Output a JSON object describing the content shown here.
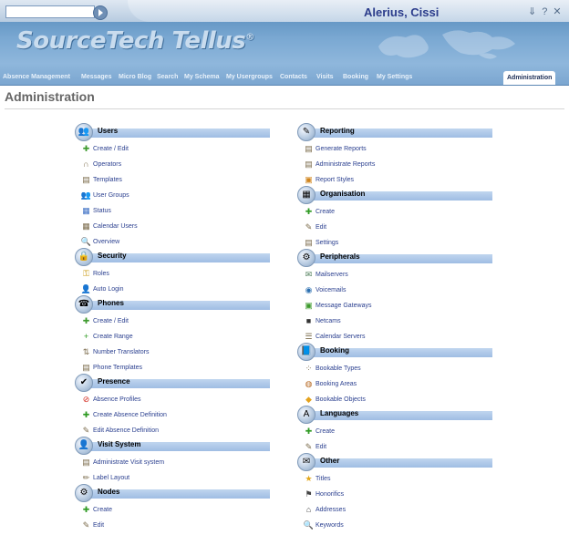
{
  "header": {
    "user_name": "Alerius, Cissi",
    "logo_text": "SourceTech Tellus",
    "logo_mark": "®",
    "top_icons": "⇓?✕"
  },
  "nav": [
    {
      "label": "Absence Management"
    },
    {
      "label": "Messages"
    },
    {
      "label": "Micro Blog"
    },
    {
      "label": "Search"
    },
    {
      "label": "My Schema"
    },
    {
      "label": "My Usergroups"
    },
    {
      "label": "Contacts"
    },
    {
      "label": "Visits"
    },
    {
      "label": "Booking"
    },
    {
      "label": "My Settings"
    },
    {
      "label": "Administration"
    }
  ],
  "page": {
    "title": "Administration"
  },
  "left_sections": [
    {
      "title": "Users",
      "icon": "users-icon",
      "items": [
        {
          "label": "Create / Edit",
          "icon": "person-add-icon"
        },
        {
          "label": "Operators",
          "icon": "headset-icon"
        },
        {
          "label": "Templates",
          "icon": "template-icon"
        },
        {
          "label": "User Groups",
          "icon": "group-icon"
        },
        {
          "label": "Status",
          "icon": "status-icon"
        },
        {
          "label": "Calendar Users",
          "icon": "calendar-users-icon"
        },
        {
          "label": "Overview",
          "icon": "magnifier-icon"
        }
      ]
    },
    {
      "title": "Security",
      "icon": "security-icon",
      "items": [
        {
          "label": "Roles",
          "icon": "key-icon"
        },
        {
          "label": "Auto Login",
          "icon": "auto-login-icon"
        }
      ]
    },
    {
      "title": "Phones",
      "icon": "phones-icon",
      "items": [
        {
          "label": "Create / Edit",
          "icon": "person-add-icon"
        },
        {
          "label": "Create Range",
          "icon": "plus-range-icon"
        },
        {
          "label": "Number Translators",
          "icon": "translate-icon"
        },
        {
          "label": "Phone Templates",
          "icon": "template-icon"
        }
      ]
    },
    {
      "title": "Presence",
      "icon": "presence-icon",
      "items": [
        {
          "label": "Absence Profiles",
          "icon": "no-entry-icon"
        },
        {
          "label": "Create Absence Definition",
          "icon": "plus-icon"
        },
        {
          "label": "Edit Absence Definition",
          "icon": "edit-icon"
        }
      ]
    },
    {
      "title": "Visit System",
      "icon": "visit-system-icon",
      "items": [
        {
          "label": "Administrate Visit system",
          "icon": "visit-admin-icon"
        },
        {
          "label": "Label Layout",
          "icon": "pencil-icon"
        }
      ]
    },
    {
      "title": "Nodes",
      "icon": "nodes-icon",
      "items": [
        {
          "label": "Create",
          "icon": "plus-icon"
        },
        {
          "label": "Edit",
          "icon": "edit-icon"
        }
      ]
    }
  ],
  "right_sections": [
    {
      "title": "Reporting",
      "icon": "reporting-icon",
      "items": [
        {
          "label": "Generate Reports",
          "icon": "report-icon"
        },
        {
          "label": "Administrate Reports",
          "icon": "report-icon"
        },
        {
          "label": "Report Styles",
          "icon": "report-style-icon"
        }
      ]
    },
    {
      "title": "Organisation",
      "icon": "organisation-icon",
      "items": [
        {
          "label": "Create",
          "icon": "plus-icon"
        },
        {
          "label": "Edit",
          "icon": "edit-icon"
        },
        {
          "label": "Settings",
          "icon": "settings-icon"
        }
      ]
    },
    {
      "title": "Peripherals",
      "icon": "peripherals-icon",
      "items": [
        {
          "label": "Mailservers",
          "icon": "mailserver-icon"
        },
        {
          "label": "Voicemails",
          "icon": "voicemail-icon"
        },
        {
          "label": "Message Gateways",
          "icon": "gateway-icon"
        },
        {
          "label": "Netcams",
          "icon": "camera-icon"
        },
        {
          "label": "Calendar Servers",
          "icon": "server-icon"
        }
      ]
    },
    {
      "title": "Booking",
      "icon": "booking-icon",
      "items": [
        {
          "label": "Bookable Types",
          "icon": "types-icon"
        },
        {
          "label": "Booking Areas",
          "icon": "area-icon"
        },
        {
          "label": "Bookable Objects",
          "icon": "object-icon"
        }
      ]
    },
    {
      "title": "Languages",
      "icon": "languages-icon",
      "items": [
        {
          "label": "Create",
          "icon": "plus-icon"
        },
        {
          "label": "Edit",
          "icon": "edit-icon"
        }
      ]
    },
    {
      "title": "Other",
      "icon": "other-icon",
      "items": [
        {
          "label": "Titles",
          "icon": "star-icon"
        },
        {
          "label": "Honorifics",
          "icon": "honorific-icon"
        },
        {
          "label": "Addresses",
          "icon": "house-icon"
        },
        {
          "label": "Keywords",
          "icon": "keyword-icon"
        }
      ]
    }
  ],
  "colors": {
    "link": "#2a3f8f",
    "section_bar": "#b5cdea",
    "header": "#6f9ccb"
  }
}
